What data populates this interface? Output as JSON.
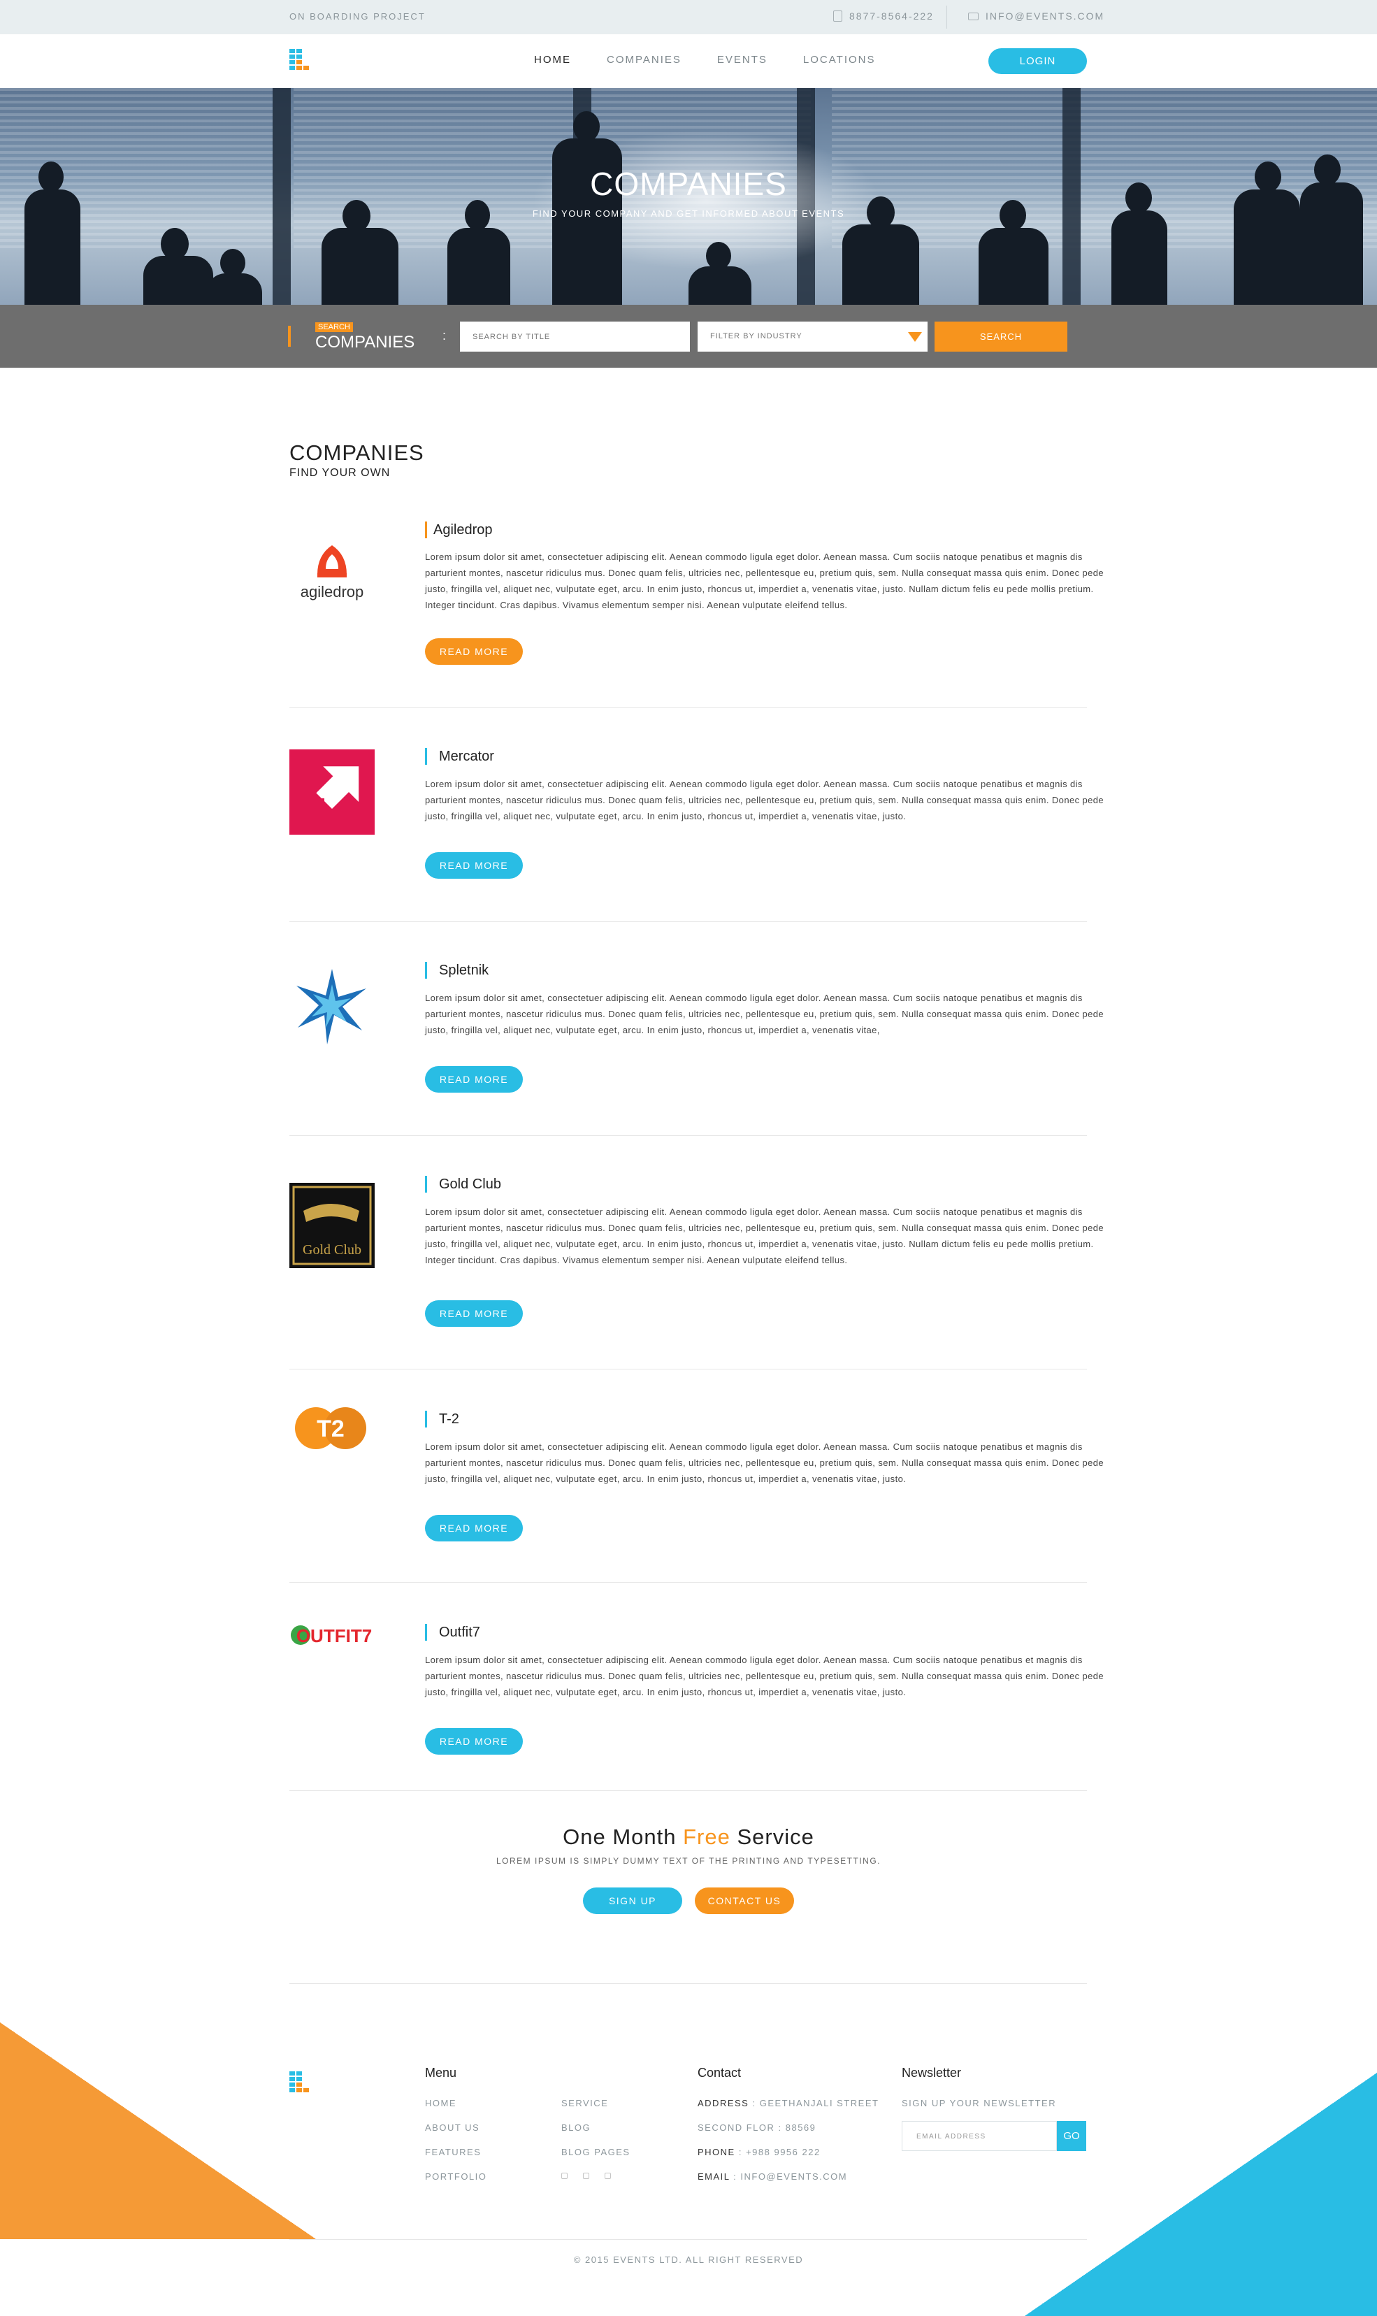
{
  "topbar": {
    "project": "ON BOARDING PROJECT",
    "phone": "8877-8564-222",
    "email": "INFO@EVENTS.COM"
  },
  "nav": {
    "items": [
      "HOME",
      "COMPANIES",
      "EVENTS",
      "LOCATIONS"
    ],
    "active": "HOME",
    "login": "LOGIN"
  },
  "hero": {
    "title": "COMPANIES",
    "subtitle": "FIND YOUR COMPANY AND GET INFORMED ABOUT EVENTS"
  },
  "search": {
    "tag": "SEARCH",
    "label": "COMPANIES",
    "colon": ":",
    "title_placeholder": "SEARCH BY TITLE",
    "filter_value": "FILTER BY INDUSTRY",
    "button": "SEARCH"
  },
  "section": {
    "title": "COMPANIES",
    "subtitle": "FIND YOUR OWN"
  },
  "companies": [
    {
      "name": "Agiledrop",
      "logo_text": "agiledrop",
      "description": "Lorem ipsum dolor sit amet, consectetuer adipiscing elit. Aenean commodo ligula eget dolor. Aenean massa. Cum sociis natoque penatibus et magnis dis parturient montes, nascetur ridiculus mus. Donec quam felis, ultricies nec, pellentesque eu, pretium quis, sem. Nulla consequat massa quis enim. Donec pede justo, fringilla vel, aliquet nec, vulputate eget, arcu. In enim justo, rhoncus ut, imperdiet a, venenatis vitae, justo. Nullam dictum felis eu pede mollis pretium. Integer tincidunt. Cras dapibus. Vivamus elementum semper nisi. Aenean vulputate eleifend tellus.",
      "button": "READ MORE"
    },
    {
      "name": "Mercator",
      "description": "Lorem ipsum dolor sit amet, consectetuer adipiscing elit. Aenean commodo ligula eget dolor. Aenean massa. Cum sociis natoque penatibus et magnis dis parturient montes, nascetur ridiculus mus. Donec quam felis, ultricies nec, pellentesque eu, pretium quis, sem. Nulla consequat massa quis enim. Donec pede justo, fringilla vel, aliquet nec, vulputate eget, arcu. In enim justo, rhoncus ut, imperdiet a, venenatis vitae, justo.",
      "button": "READ MORE"
    },
    {
      "name": "Spletnik",
      "description": "Lorem ipsum dolor sit amet, consectetuer adipiscing elit. Aenean commodo ligula eget dolor. Aenean massa. Cum sociis natoque penatibus et magnis dis parturient montes, nascetur ridiculus mus. Donec quam felis, ultricies nec, pellentesque eu, pretium quis, sem. Nulla consequat massa quis enim. Donec pede justo, fringilla vel, aliquet nec, vulputate eget, arcu. In enim justo, rhoncus ut, imperdiet a, venenatis vitae,",
      "button": "READ MORE"
    },
    {
      "name": "Gold Club",
      "logo_text": "Gold Club",
      "description": "Lorem ipsum dolor sit amet, consectetuer adipiscing elit. Aenean commodo ligula eget dolor. Aenean massa. Cum sociis natoque penatibus et magnis dis parturient montes, nascetur ridiculus mus. Donec quam felis, ultricies nec, pellentesque eu, pretium quis, sem. Nulla consequat massa quis enim. Donec pede justo, fringilla vel, aliquet nec, vulputate eget, arcu. In enim justo, rhoncus ut, imperdiet a, venenatis vitae, justo. Nullam dictum felis eu pede mollis pretium. Integer tincidunt. Cras dapibus. Vivamus elementum semper nisi. Aenean vulputate eleifend tellus.",
      "button": "READ MORE"
    },
    {
      "name": "T-2",
      "logo_text": "T2",
      "description": "Lorem ipsum dolor sit amet, consectetuer adipiscing elit. Aenean commodo ligula eget dolor. Aenean massa. Cum sociis natoque penatibus et magnis dis parturient montes, nascetur ridiculus mus. Donec quam felis, ultricies nec, pellentesque eu, pretium quis, sem. Nulla consequat massa quis enim. Donec pede justo, fringilla vel, aliquet nec, vulputate eget, arcu. In enim justo, rhoncus ut, imperdiet a, venenatis vitae, justo.",
      "button": "READ MORE"
    },
    {
      "name": "Outfit7",
      "logo_text": "OUTFIT7",
      "description": "Lorem ipsum dolor sit amet, consectetuer adipiscing elit. Aenean commodo ligula eget dolor. Aenean massa. Cum sociis natoque penatibus et magnis dis parturient montes, nascetur ridiculus mus. Donec quam felis, ultricies nec, pellentesque eu, pretium quis, sem. Nulla consequat massa quis enim. Donec pede justo, fringilla vel, aliquet nec, vulputate eget, arcu. In enim justo, rhoncus ut, imperdiet a, venenatis vitae, justo.",
      "button": "READ MORE"
    }
  ],
  "promo": {
    "title_pre": "One Month ",
    "title_free": "Free",
    "title_post": " Service",
    "subtitle": "LOREM IPSUM IS SIMPLY DUMMY TEXT OF THE PRINTING AND TYPESETTING.",
    "signup": "SIGN UP",
    "contact": "CONTACT US"
  },
  "footer": {
    "menu_title": "Menu",
    "menu_col1": [
      "HOME",
      "ABOUT US",
      "FEATURES",
      "PORTFOLIO"
    ],
    "menu_col2": [
      "SERVICE",
      "BLOG",
      "BLOG PAGES"
    ],
    "contact_title": "Contact",
    "address_label": "ADDRESS",
    "address_value": "GEETHANJALI STREET",
    "address_line2": "SECOND FLOR : 88569",
    "phone_label": "PHONE",
    "phone_value": "+988 9956 222",
    "email_label": "EMAIL",
    "email_value": "INFO@EVENTS.COM",
    "newsletter_title": "Newsletter",
    "newsletter_sub": "SIGN UP YOUR NEWSLETTER",
    "newsletter_placeholder": "EMAIL ADDRESS",
    "newsletter_go": "GO",
    "copyright": "© 2015 EVENTS LTD. ALL RIGHT RESERVED"
  },
  "colors": {
    "accent_blue": "#29bde4",
    "accent_orange": "#f7941d",
    "searchbar_bg": "#6e6e6e",
    "topbar_bg": "#e8eef0"
  }
}
